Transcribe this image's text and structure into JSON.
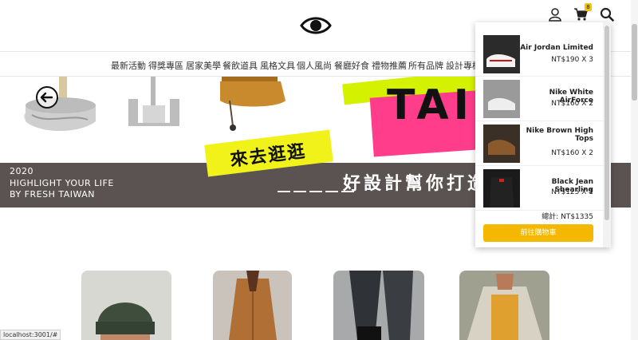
{
  "header": {
    "logo_icon": "eye-icon",
    "user_icon": "user-icon",
    "cart_icon": "cart-icon",
    "cart_count": "8",
    "search_icon": "search-icon"
  },
  "nav": {
    "items": [
      "最新活動",
      "得獎專區",
      "居家美學",
      "餐飲道具",
      "風格文具",
      "個人風尚",
      "餐廳好食",
      "禮物推薦",
      "所有品牌",
      "設計專欄"
    ]
  },
  "hero": {
    "year": "2020",
    "line1": "HIGHLIGHT YOUR LIFE",
    "line2": "BY FRESH TAIWAN",
    "tag": "來去逛逛",
    "headline": "好設計幫你打造",
    "tai": "TAI",
    "prev_icon": "arrow-left-icon",
    "slide_count": 5
  },
  "cart": {
    "items": [
      {
        "name": "Air Jordan Limited",
        "price": "NT$190 X 3"
      },
      {
        "name": "Nike White AirForce",
        "price": "NT$160 X 2"
      },
      {
        "name": "Nike Brown High Tops",
        "price": "NT$160 X 2"
      },
      {
        "name": "Black Jean Shearling",
        "price": "NT$125 X 1"
      }
    ],
    "total": "總計: NT$1335",
    "checkout": "前往購物車"
  },
  "status": {
    "url": "localhost:3001/#"
  },
  "colors": {
    "accent": "#f5b800",
    "band": "#5b5352",
    "pink": "#ff3d8b",
    "lime": "#d4f200",
    "yellow": "#f0f21a"
  }
}
